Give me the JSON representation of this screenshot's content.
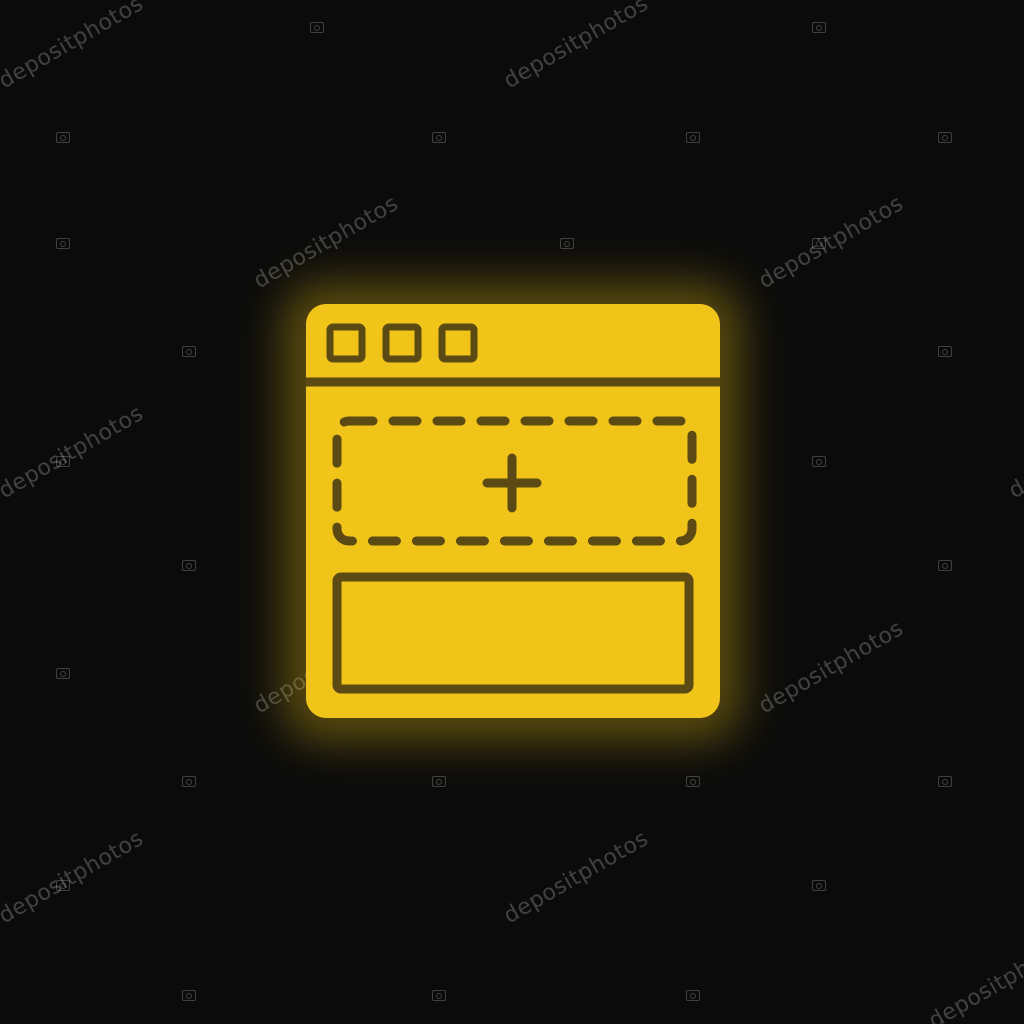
{
  "icon": {
    "name": "web-page-add-section-icon",
    "style": "yellow neon glow",
    "fill_color": "#f0c419",
    "stroke_color": "#5c4a14",
    "glow_color": "#f0c419",
    "background_color": "#0b0b0b",
    "window_buttons": 3,
    "placeholder_symbol": "+"
  },
  "watermark": {
    "text": "depositphotos",
    "color": "#ffffff"
  }
}
